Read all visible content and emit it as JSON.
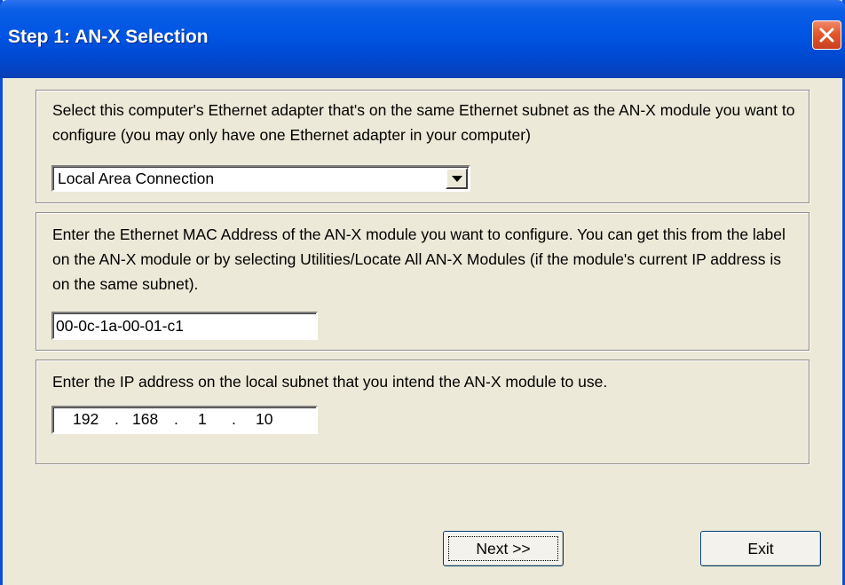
{
  "window": {
    "title": "Step 1: AN-X Selection"
  },
  "adapter_group": {
    "description": "Select this computer's Ethernet adapter that's on the same Ethernet subnet as the AN-X module you want to configure (you may only have one Ethernet adapter in your computer)",
    "selected_adapter": "Local Area Connection"
  },
  "mac_group": {
    "description": "Enter the Ethernet MAC Address of the AN-X module you want to configure. You can get this from the label on the AN-X module or by selecting Utilities/Locate All AN-X Modules (if the module's current IP address is on the same subnet).",
    "mac_value": "00-0c-1a-00-01-c1"
  },
  "ip_group": {
    "description": "Enter the IP address on the local subnet that you intend the AN-X module to use.",
    "octets": [
      "192",
      "168",
      "1",
      "10"
    ],
    "separator": "."
  },
  "buttons": {
    "next_label": "Next >>",
    "exit_label": "Exit"
  },
  "colors": {
    "titlebar": "#0055e3",
    "dialog_bg": "#ece9d8",
    "close_button": "#e2572d"
  }
}
